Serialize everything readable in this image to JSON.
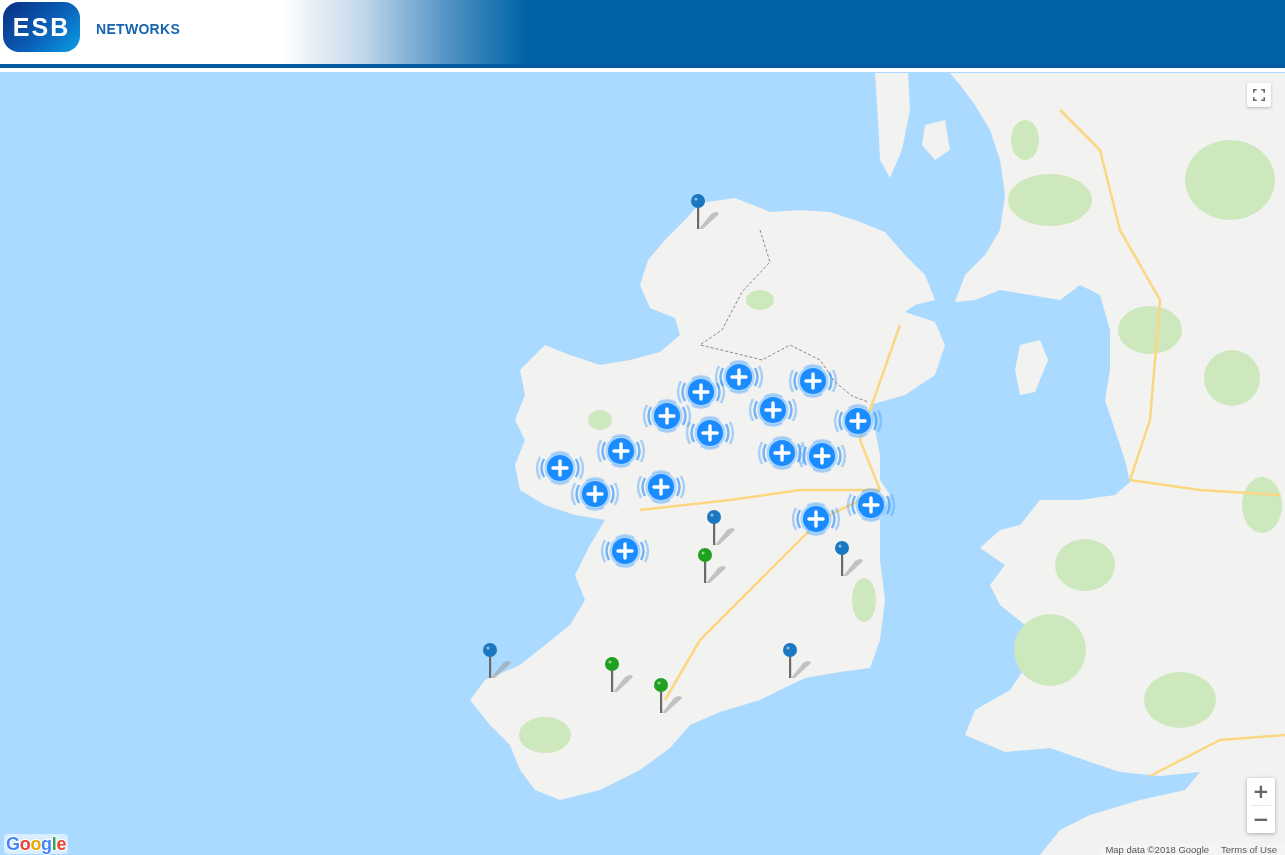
{
  "header": {
    "logo_text": "ESB",
    "brand": "NETWORKS"
  },
  "map": {
    "markers": [
      {
        "kind": "cluster"
      },
      {
        "kind": "cluster"
      },
      {
        "kind": "cluster"
      },
      {
        "kind": "cluster"
      },
      {
        "kind": "cluster"
      },
      {
        "kind": "cluster"
      },
      {
        "kind": "cluster"
      },
      {
        "kind": "cluster"
      },
      {
        "kind": "cluster"
      },
      {
        "kind": "cluster"
      },
      {
        "kind": "cluster"
      },
      {
        "kind": "cluster"
      },
      {
        "kind": "cluster"
      },
      {
        "kind": "cluster"
      },
      {
        "kind": "cluster"
      },
      {
        "kind": "cluster"
      },
      {
        "kind": "pin",
        "color": "#1a78c2"
      },
      {
        "kind": "pin",
        "color": "#1a78c2"
      },
      {
        "kind": "pin",
        "color": "#1a78c2"
      },
      {
        "kind": "pin",
        "color": "#1fa01f"
      },
      {
        "kind": "pin",
        "color": "#1a78c2"
      },
      {
        "kind": "pin",
        "color": "#1a78c2"
      },
      {
        "kind": "pin",
        "color": "#1fa01f"
      },
      {
        "kind": "pin",
        "color": "#1fa01f"
      }
    ],
    "zoom_controls": {
      "zoom_in": "+",
      "zoom_out": "−"
    },
    "google_logo": "Google",
    "attribution": "Map data ©2018 Google",
    "terms_link": "Terms of Use"
  }
}
